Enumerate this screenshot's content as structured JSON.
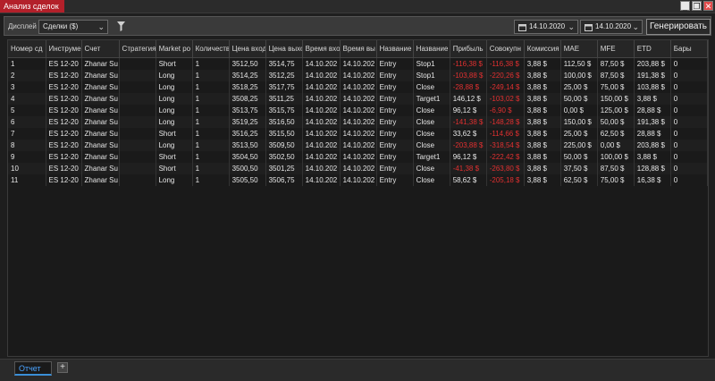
{
  "window": {
    "title": "Анализ сделок"
  },
  "toolbar": {
    "display_label": "Дисплей",
    "display_value": "Сделки ($)",
    "date_from": "14.10.2020",
    "date_to": "14.10.2020",
    "generate_label": "Генерировать"
  },
  "table": {
    "headers": [
      "Номер сд",
      "Инструме",
      "Счет",
      "Стратегия",
      "Market po",
      "Количеств",
      "Цена вход",
      "Цена выхо",
      "Время вхо",
      "Время вы",
      "Название",
      "Название",
      "Прибыль",
      "Совокупн",
      "Комиссия",
      "MAE",
      "MFE",
      "ETD",
      "Бары"
    ],
    "rows": [
      [
        "1",
        "ES 12-20",
        "Zhanar Su",
        "",
        "Short",
        "1",
        "3512,50",
        "3514,75",
        "14.10.202",
        "14.10.202",
        "Entry",
        "Stop1",
        "-116,38 $",
        "-116,38 $",
        "3,88 $",
        "112,50 $",
        "87,50 $",
        "203,88 $",
        "0"
      ],
      [
        "2",
        "ES 12-20",
        "Zhanar Su",
        "",
        "Long",
        "1",
        "3514,25",
        "3512,25",
        "14.10.202",
        "14.10.202",
        "Entry",
        "Stop1",
        "-103,88 $",
        "-220,26 $",
        "3,88 $",
        "100,00 $",
        "87,50 $",
        "191,38 $",
        "0"
      ],
      [
        "3",
        "ES 12-20",
        "Zhanar Su",
        "",
        "Long",
        "1",
        "3518,25",
        "3517,75",
        "14.10.202",
        "14.10.202",
        "Entry",
        "Close",
        "-28,88 $",
        "-249,14 $",
        "3,88 $",
        "25,00 $",
        "75,00 $",
        "103,88 $",
        "0"
      ],
      [
        "4",
        "ES 12-20",
        "Zhanar Su",
        "",
        "Long",
        "1",
        "3508,25",
        "3511,25",
        "14.10.202",
        "14.10.202",
        "Entry",
        "Target1",
        "146,12 $",
        "-103,02 $",
        "3,88 $",
        "50,00 $",
        "150,00 $",
        "3,88 $",
        "0"
      ],
      [
        "5",
        "ES 12-20",
        "Zhanar Su",
        "",
        "Long",
        "1",
        "3513,75",
        "3515,75",
        "14.10.202",
        "14.10.202",
        "Entry",
        "Close",
        "96,12 $",
        "-6,90 $",
        "3,88 $",
        "0,00 $",
        "125,00 $",
        "28,88 $",
        "0"
      ],
      [
        "6",
        "ES 12-20",
        "Zhanar Su",
        "",
        "Long",
        "1",
        "3519,25",
        "3516,50",
        "14.10.202",
        "14.10.202",
        "Entry",
        "Close",
        "-141,38 $",
        "-148,28 $",
        "3,88 $",
        "150,00 $",
        "50,00 $",
        "191,38 $",
        "0"
      ],
      [
        "7",
        "ES 12-20",
        "Zhanar Su",
        "",
        "Short",
        "1",
        "3516,25",
        "3515,50",
        "14.10.202",
        "14.10.202",
        "Entry",
        "Close",
        "33,62 $",
        "-114,66 $",
        "3,88 $",
        "25,00 $",
        "62,50 $",
        "28,88 $",
        "0"
      ],
      [
        "8",
        "ES 12-20",
        "Zhanar Su",
        "",
        "Long",
        "1",
        "3513,50",
        "3509,50",
        "14.10.202",
        "14.10.202",
        "Entry",
        "Close",
        "-203,88 $",
        "-318,54 $",
        "3,88 $",
        "225,00 $",
        "0,00 $",
        "203,88 $",
        "0"
      ],
      [
        "9",
        "ES 12-20",
        "Zhanar Su",
        "",
        "Short",
        "1",
        "3504,50",
        "3502,50",
        "14.10.202",
        "14.10.202",
        "Entry",
        "Target1",
        "96,12 $",
        "-222,42 $",
        "3,88 $",
        "50,00 $",
        "100,00 $",
        "3,88 $",
        "0"
      ],
      [
        "10",
        "ES 12-20",
        "Zhanar Su",
        "",
        "Short",
        "1",
        "3500,50",
        "3501,25",
        "14.10.202",
        "14.10.202",
        "Entry",
        "Close",
        "-41,38 $",
        "-263,80 $",
        "3,88 $",
        "37,50 $",
        "87,50 $",
        "128,88 $",
        "0"
      ],
      [
        "11",
        "ES 12-20",
        "Zhanar Su",
        "",
        "Long",
        "1",
        "3505,50",
        "3506,75",
        "14.10.202",
        "14.10.202",
        "Entry",
        "Close",
        "58,62 $",
        "-205,18 $",
        "3,88 $",
        "62,50 $",
        "75,00 $",
        "16,38 $",
        "0"
      ]
    ]
  },
  "bottom": {
    "tab_label": "Отчет",
    "add_label": "+"
  },
  "colors": {
    "accent": "#b3202a",
    "negative": "#e03030",
    "tab_active": "#4aa3ff"
  }
}
